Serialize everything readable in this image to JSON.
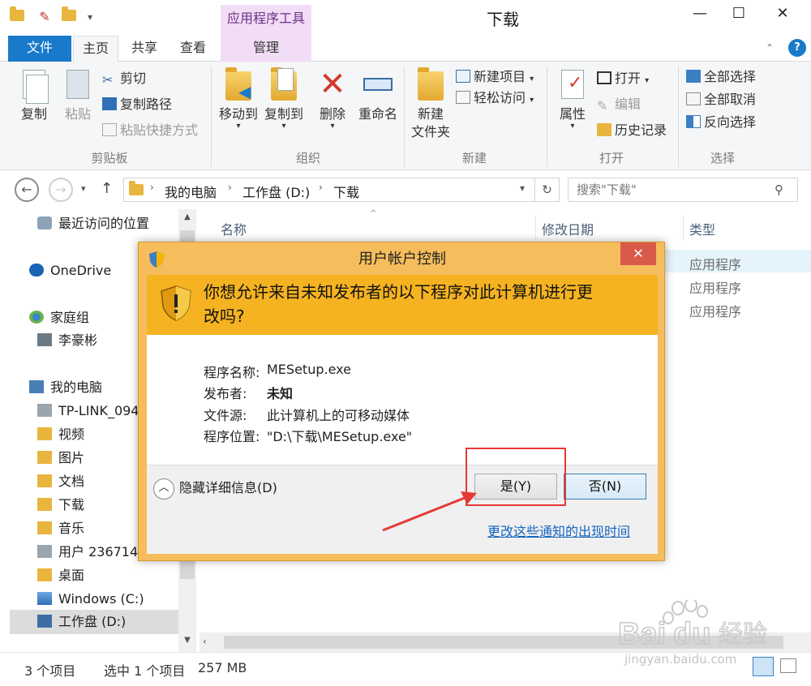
{
  "window": {
    "title": "下载",
    "context_tab_group": "应用程序工具",
    "buttons": {
      "minimize": "—",
      "maximize": "☐",
      "close": "✕"
    }
  },
  "ribbon_tabs": {
    "file": "文件",
    "home": "主页",
    "share": "共享",
    "view": "查看",
    "manage": "管理"
  },
  "ribbon": {
    "clipboard": {
      "label": "剪贴板",
      "copy": "复制",
      "paste": "粘贴",
      "cut": "剪切",
      "copy_path": "复制路径",
      "paste_shortcut": "粘贴快捷方式"
    },
    "organize": {
      "label": "组织",
      "move_to": "移动到",
      "copy_to": "复制到",
      "delete": "删除",
      "rename": "重命名"
    },
    "new": {
      "label": "新建",
      "new_folder_line1": "新建",
      "new_folder_line2": "文件夹",
      "new_item": "新建项目",
      "easy_access": "轻松访问"
    },
    "open": {
      "label": "打开",
      "properties": "属性",
      "open": "打开",
      "edit": "编辑",
      "history": "历史记录"
    },
    "select": {
      "label": "选择",
      "select_all": "全部选择",
      "select_none": "全部取消",
      "invert": "反向选择"
    }
  },
  "address": {
    "breadcrumbs": [
      "我的电脑",
      "工作盘 (D:)",
      "下载"
    ],
    "search_placeholder": "搜索\"下载\""
  },
  "nav_pane": {
    "recent": "最近访问的位置",
    "onedrive": "OneDrive",
    "homegroup": "家庭组",
    "homegroup_user": "李豪彬",
    "this_pc": "我的电脑",
    "items": [
      "TP-LINK_094",
      "视频",
      "图片",
      "文档",
      "下载",
      "音乐",
      "用户 236714",
      "桌面",
      "Windows (C:)",
      "工作盘 (D:)"
    ]
  },
  "file_list": {
    "columns": {
      "name": "名称",
      "modified": "修改日期",
      "type": "类型"
    },
    "types": [
      "应用程序",
      "应用程序",
      "应用程序"
    ]
  },
  "status_bar": {
    "item_count": "3 个项目",
    "selection": "选中 1 个项目",
    "size": "257 MB"
  },
  "uac_dialog": {
    "title": "用户帐户控制",
    "close": "✕",
    "question_line1": "你想允许来自未知发布者的以下程序对此计算机进行更",
    "question_line2": "改吗?",
    "fields": {
      "program_name_key": "程序名称:",
      "program_name_val": "MESetup.exe",
      "publisher_key": "发布者:",
      "publisher_val": "未知",
      "origin_key": "文件源:",
      "origin_val": "此计算机上的可移动媒体",
      "location_key": "程序位置:",
      "location_val": "\"D:\\下载\\MESetup.exe\""
    },
    "hide_details": "隐藏详细信息(D)",
    "yes": "是(Y)",
    "no": "否(N)",
    "change_notification_link": "更改这些通知的出现时间"
  },
  "watermark": {
    "brand": "Bai",
    "brand2": "du",
    "brand_cn": "经验",
    "url": "jingyan.baidu.com"
  },
  "colors": {
    "accent": "#1979ca",
    "uac_frame": "#f6bd5c",
    "uac_banner": "#f5b321",
    "annotation_red": "#e53935",
    "context_tab": "#f1ddf5"
  }
}
